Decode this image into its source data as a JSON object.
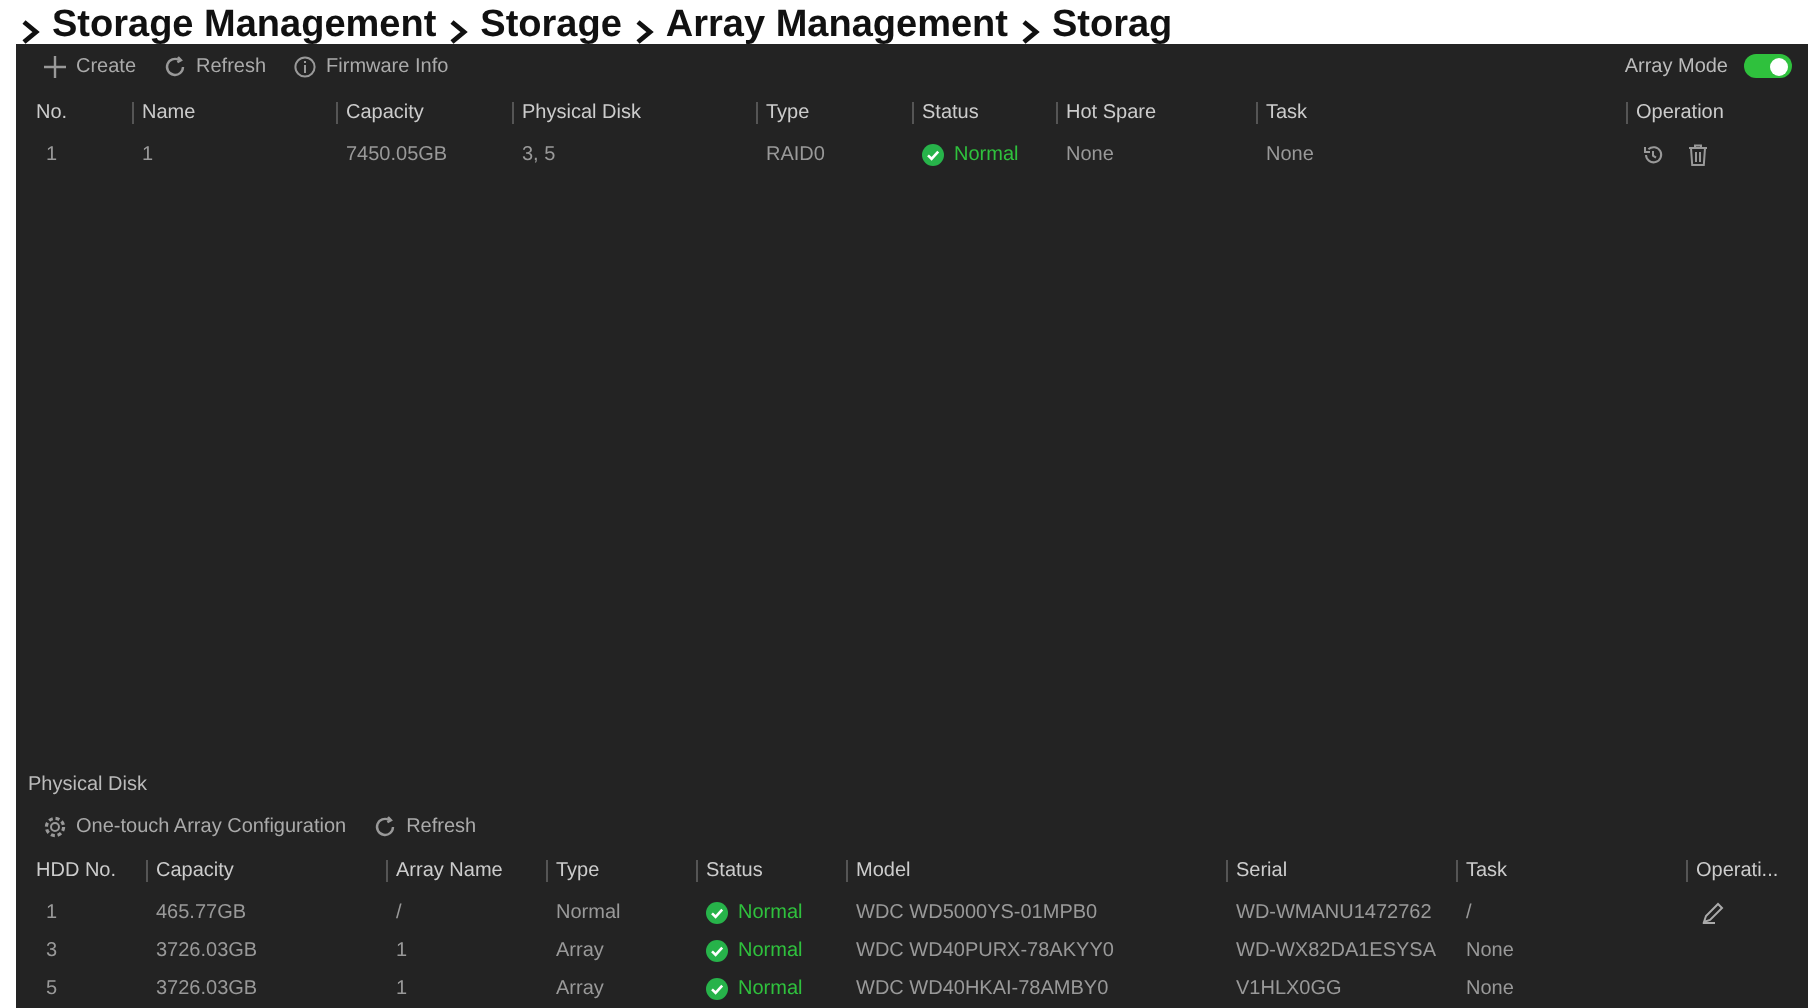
{
  "breadcrumb": [
    "Storage Management",
    "Storage",
    "Array Management",
    "Storag"
  ],
  "toolbar": {
    "buttons": [
      {
        "kind": "create",
        "label": "Create"
      },
      {
        "kind": "refresh",
        "label": "Refresh"
      },
      {
        "kind": "info",
        "label": "Firmware Info"
      }
    ],
    "array_mode": {
      "label": "Array Mode",
      "on": true
    }
  },
  "array_table": {
    "columns": [
      "No.",
      "Name",
      "Capacity",
      "Physical Disk",
      "Type",
      "Status",
      "Hot Spare",
      "Task",
      "Operation"
    ],
    "rows": [
      {
        "cells": [
          "1",
          "1",
          "7450.05GB",
          "3, 5",
          "RAID0",
          "Normal",
          "None",
          "None"
        ]
      }
    ]
  },
  "physical_disk": {
    "title": "Physical Disk",
    "buttons": [
      {
        "kind": "config",
        "label": "One-touch Array Configuration"
      },
      {
        "kind": "refresh",
        "label": "Refresh"
      }
    ],
    "columns": [
      "HDD No.",
      "Capacity",
      "Array Name",
      "Type",
      "Status",
      "Model",
      "Serial",
      "Task",
      "Operati..."
    ],
    "rows": [
      {
        "cells": [
          "1",
          "465.77GB",
          "/",
          "Normal",
          "Normal",
          "WDC WD5000YS-01MPB0",
          "WD-WMANU1472762",
          "/"
        ],
        "editable": true
      },
      {
        "cells": [
          "3",
          "3726.03GB",
          "1",
          "Array",
          "Normal",
          "WDC WD40PURX-78AKYY0",
          "WD-WX82DA1ESYSA",
          "None"
        ],
        "editable": false
      },
      {
        "cells": [
          "5",
          "3726.03GB",
          "1",
          "Array",
          "Normal",
          "WDC WD40HKAI-78AMBY0",
          "V1HLX0GG",
          "None"
        ],
        "editable": false
      }
    ]
  }
}
